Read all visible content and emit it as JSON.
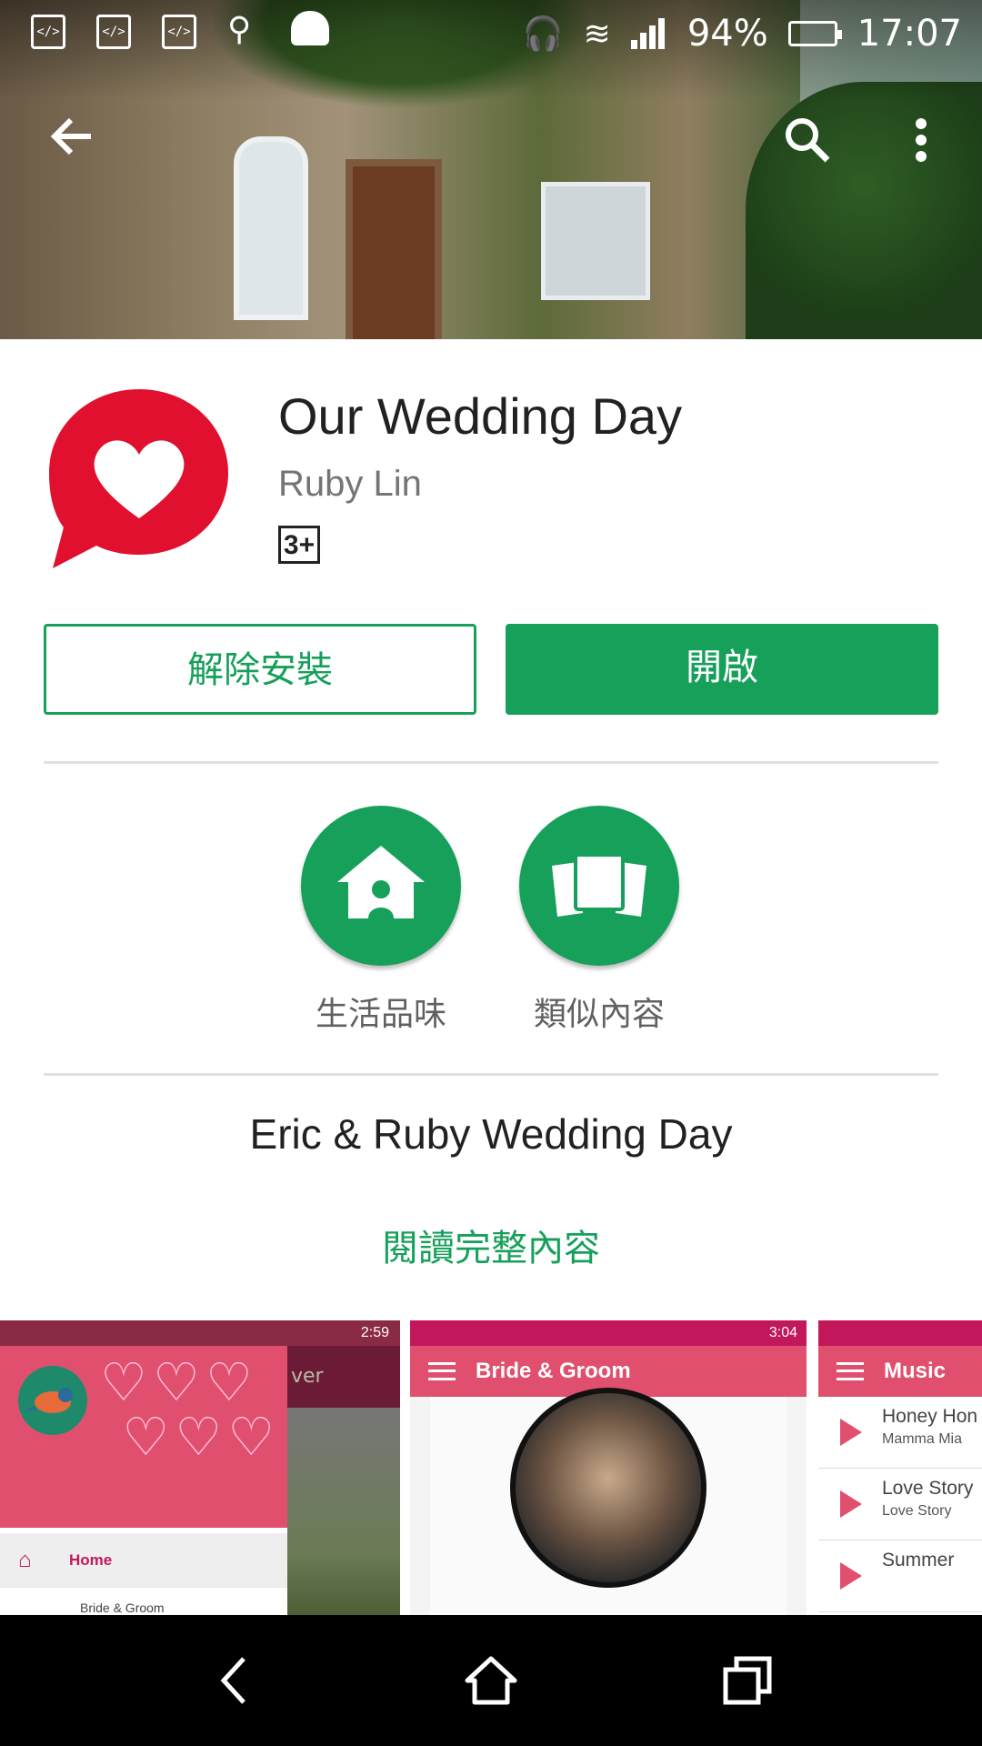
{
  "status_bar": {
    "dev_icon_label": "</>",
    "battery": "94%",
    "time": "17:07"
  },
  "app": {
    "title": "Our Wedding Day",
    "developer": "Ruby Lin",
    "rating": "3+",
    "brand_color": "#e0102e",
    "accent_color": "#16a05a"
  },
  "actions": {
    "uninstall_label": "解除安裝",
    "open_label": "開啟"
  },
  "categories": [
    {
      "label": "生活品味",
      "icon": "house-icon"
    },
    {
      "label": "類似內容",
      "icon": "similar-cards-icon"
    }
  ],
  "description": {
    "title": "Eric & Ruby Wedding Day",
    "read_more": "閱讀完整內容"
  },
  "screenshots": {
    "shot1": {
      "time": "2:59",
      "ghost_title": "ver",
      "menu_items": [
        "Home",
        "Bride & Groom"
      ]
    },
    "shot2": {
      "time": "3:04",
      "toolbar_title": "Bride & Groom"
    },
    "shot3": {
      "toolbar_title": "Music",
      "songs": [
        {
          "title": "Honey Hon",
          "subtitle": "Mamma Mia"
        },
        {
          "title": "Love Story",
          "subtitle": "Love Story"
        },
        {
          "title": "Summer",
          "subtitle": ""
        }
      ]
    }
  },
  "navbar": {
    "back": "back-icon",
    "home": "home-icon",
    "recents": "recents-icon"
  }
}
